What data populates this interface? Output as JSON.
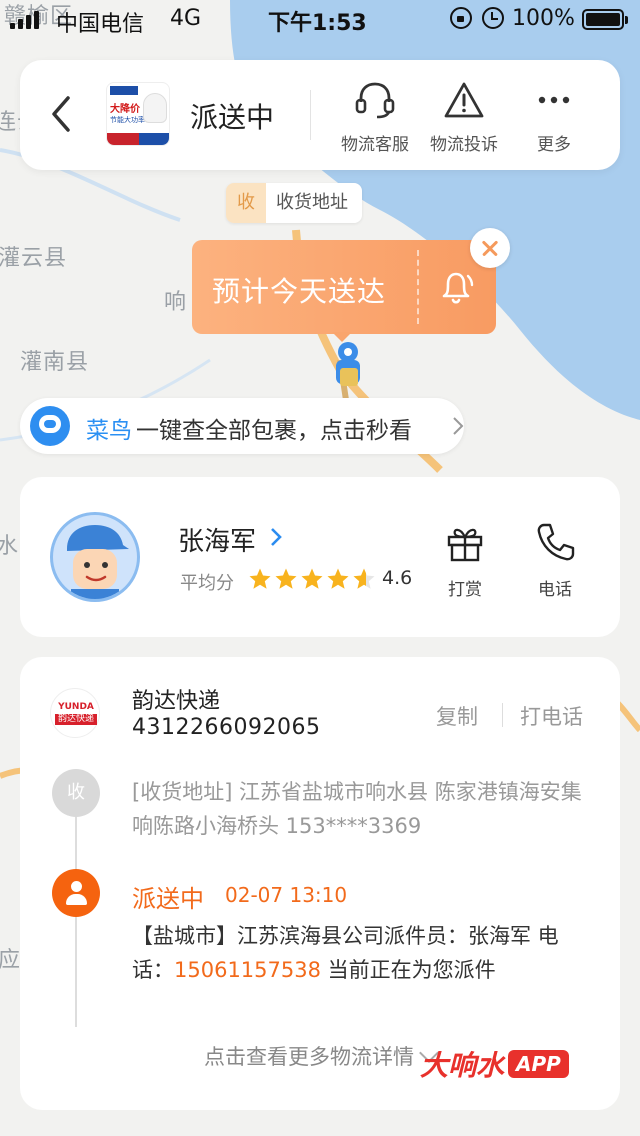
{
  "status_bar": {
    "carrier": "中国电信",
    "network": "4G",
    "time": "下午1:53",
    "battery": "100%"
  },
  "map": {
    "labels": [
      "赣榆区",
      "连云",
      "灌云县",
      "响",
      "灌南县",
      "水",
      "应"
    ]
  },
  "header": {
    "title": "派送中",
    "product_thumb": {
      "big_text": "大降价",
      "small_text": "节能大功率"
    },
    "actions": [
      {
        "label": "物流客服",
        "icon": "headset-icon"
      },
      {
        "label": "物流投诉",
        "icon": "warning-icon"
      },
      {
        "label": "更多",
        "icon": "more-icon"
      }
    ]
  },
  "address_pin": {
    "badge": "收",
    "label": "收货地址"
  },
  "eta": {
    "text": "预计今天送达"
  },
  "cainiao": {
    "brand": "菜鸟",
    "message": "一键查全部包裹，点击秒看"
  },
  "courier": {
    "name": "张海军",
    "score_label": "平均分",
    "rating": 4.6,
    "rating_text": "4.6",
    "actions": [
      {
        "label": "打赏",
        "icon": "gift-icon"
      },
      {
        "label": "电话",
        "icon": "phone-icon"
      }
    ]
  },
  "tracking": {
    "company_logo": {
      "en": "YUNDA",
      "cn": "韵达快递"
    },
    "company": "韵达快递",
    "tracking_number": "4312266092065",
    "copy_label": "复制",
    "call_label": "打电话",
    "address_badge": "收",
    "address": "[收货地址] 江苏省盐城市响水县  陈家港镇海安集响陈路小海桥头 153****3369",
    "status": "派送中",
    "status_time": "02-07 13:10",
    "detail_prefix": "【盐城市】江苏滨海县公司派件员：张海军 电话：",
    "detail_phone": "15061157538",
    "detail_suffix": " 当前正在为您派件",
    "more_link": "点击查看更多物流详情"
  },
  "watermark": {
    "text": "大响水",
    "app": "APP"
  },
  "colors": {
    "accent_orange": "#f26a1b",
    "eta_gradient_start": "#fcb27f",
    "eta_gradient_end": "#f89b62",
    "cainiao_blue": "#2b90f3"
  }
}
